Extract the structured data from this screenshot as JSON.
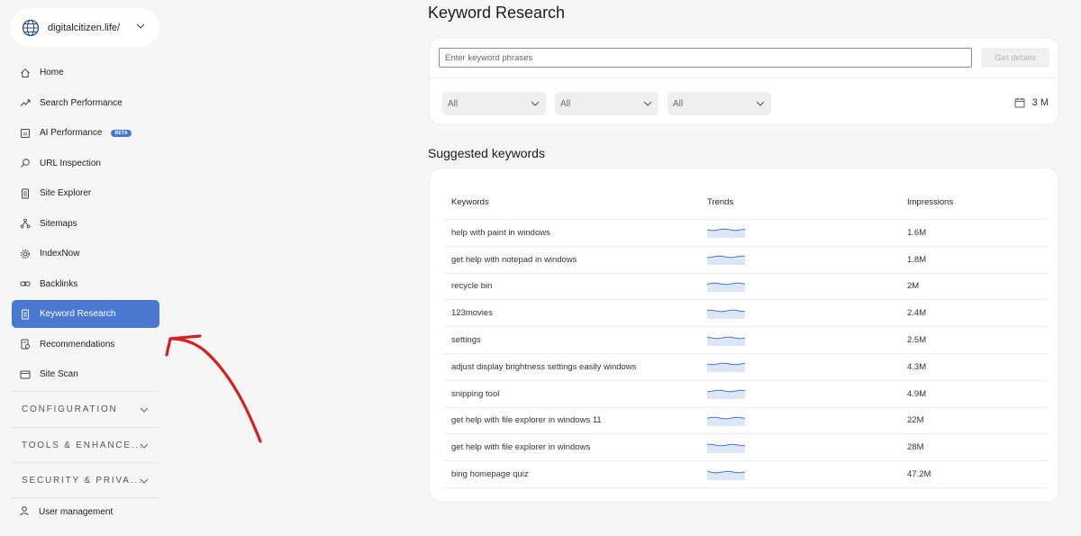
{
  "site": {
    "name": "digitalcitizen.life/"
  },
  "nav": {
    "items": [
      {
        "label": "Home",
        "icon": "home-icon"
      },
      {
        "label": "Search Performance",
        "icon": "trend-icon"
      },
      {
        "label": "AI Performance",
        "icon": "ai-icon",
        "badge": "BETA"
      },
      {
        "label": "URL Inspection",
        "icon": "search-icon"
      },
      {
        "label": "Site Explorer",
        "icon": "document-icon"
      },
      {
        "label": "Sitemaps",
        "icon": "sitemap-icon"
      },
      {
        "label": "IndexNow",
        "icon": "gear-icon"
      },
      {
        "label": "Backlinks",
        "icon": "link-icon"
      },
      {
        "label": "Keyword Research",
        "icon": "document-icon",
        "active": true
      },
      {
        "label": "Recommendations",
        "icon": "recommendations-icon"
      },
      {
        "label": "Site Scan",
        "icon": "scan-icon"
      }
    ],
    "sections": [
      "CONFIGURATION",
      "TOOLS & ENHANCE...",
      "SECURITY & PRIVA..."
    ],
    "user_management": "User management"
  },
  "main": {
    "title": "Keyword Research",
    "search": {
      "placeholder": "Enter keyword phrases",
      "button": "Get details"
    },
    "filters": [
      "All",
      "All",
      "All"
    ],
    "date_range": "3 M",
    "suggested_title": "Suggested keywords",
    "table": {
      "headers": [
        "Keywords",
        "Trends",
        "Impressions"
      ],
      "rows": [
        {
          "keyword": "help with paint in windows",
          "impressions": "1.6M"
        },
        {
          "keyword": "get help with notepad in windows",
          "impressions": "1.8M"
        },
        {
          "keyword": "recycle bin",
          "impressions": "2M"
        },
        {
          "keyword": "123movies",
          "impressions": "2.4M"
        },
        {
          "keyword": "settings",
          "impressions": "2.5M"
        },
        {
          "keyword": "adjust display brightness settings easily windows",
          "impressions": "4.3M"
        },
        {
          "keyword": "snipping tool",
          "impressions": "4.9M"
        },
        {
          "keyword": "get help with file explorer in windows 11",
          "impressions": "22M"
        },
        {
          "keyword": "get help with file explorer in windows",
          "impressions": "28M"
        },
        {
          "keyword": "bing homepage quiz",
          "impressions": "47.2M"
        }
      ]
    }
  },
  "colors": {
    "accent": "#4a77d0",
    "annotation_arrow": "#d42020",
    "sparkline": "#4a77d0"
  }
}
